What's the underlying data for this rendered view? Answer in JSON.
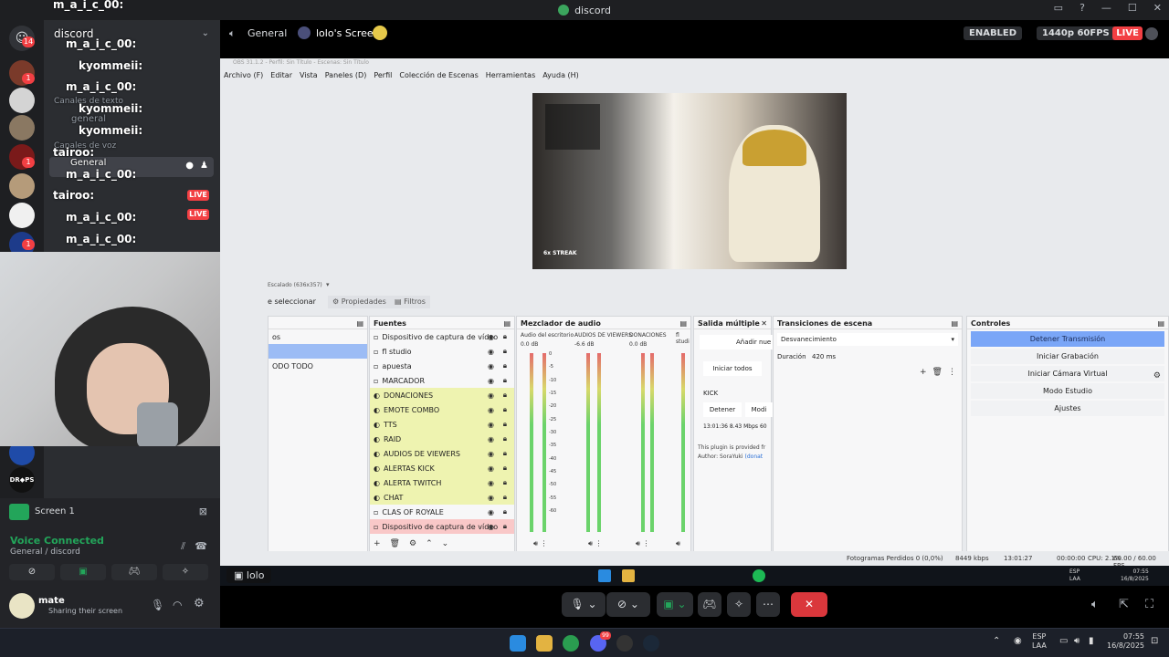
{
  "window": {
    "title": "discord"
  },
  "rail": {
    "badge_top": "14",
    "badge_1": "1",
    "badge_2": "1",
    "badge_3": "1"
  },
  "chat_overlay": {
    "lines": [
      "m_a_i_c_00:",
      "discord",
      "m_a_i_c_00:",
      "kyommeii:",
      "m_a_i_c_00:",
      "Canales de texto",
      "kyommeii:",
      "general",
      "kyommeii:",
      "Canales de voz",
      "tairoo:",
      "General",
      "m_a_i_c_00:",
      "tairoo:",
      "m_a_i_c_00:",
      "m_a_i_c_00:"
    ],
    "live_label": "LIVE"
  },
  "voice": {
    "screen_label": "Screen 1",
    "status": "Voice Connected",
    "channel": "General / discord"
  },
  "user": {
    "name": "mate",
    "status": "Sharing their screen"
  },
  "stream_header": {
    "channel": "General",
    "screen": "lolo's Screen",
    "enabled": "ENABLED",
    "quality": "1440p 60FPS",
    "live": "LIVE"
  },
  "obs": {
    "title": "OBS 31.1.2 - Perfil: Sin Título - Escenas: Sin Título",
    "menu": [
      "Archivo (F)",
      "Editar",
      "Vista",
      "Paneles (D)",
      "Perfil",
      "Colección de Escenas",
      "Herramientas",
      "Ayuda (H)"
    ],
    "preview_caption": "6x STREAK",
    "scaled_label": "Escalado (636x357)",
    "selection_label": "e seleccionar",
    "properties_btn": "Propiedades",
    "filters_btn": "Filtros",
    "scenes": [
      "os",
      "",
      "ODO TODO"
    ],
    "sources_title": "Fuentes",
    "sources": [
      {
        "name": "Dispositivo de captura de vídeo",
        "color": "none"
      },
      {
        "name": "fl studio",
        "color": "none"
      },
      {
        "name": "apuesta",
        "color": "none"
      },
      {
        "name": "MARCADOR",
        "color": "none"
      },
      {
        "name": "DONACIONES",
        "color": "yellow"
      },
      {
        "name": "EMOTE COMBO",
        "color": "yellow"
      },
      {
        "name": "TTS",
        "color": "yellow"
      },
      {
        "name": "RAID",
        "color": "yellow"
      },
      {
        "name": "AUDIOS DE VIEWERS",
        "color": "yellow"
      },
      {
        "name": "ALERTAS KICK",
        "color": "yellow"
      },
      {
        "name": "ALERTA TWITCH",
        "color": "yellow"
      },
      {
        "name": "CHAT",
        "color": "yellow"
      },
      {
        "name": "CLAS OF ROYALE",
        "color": "none"
      },
      {
        "name": "Dispositivo de captura de vídeo",
        "color": "red"
      }
    ],
    "mixer_title": "Mezclador de audio",
    "mixer_channels": [
      {
        "name": "Audio del escritorio",
        "db": "0.0 dB"
      },
      {
        "name": "AUDIOS DE VIEWERS",
        "db": "-6.6 dB"
      },
      {
        "name": "DONACIONES",
        "db": "0.0 dB"
      },
      {
        "name": "fl studi",
        "db": ""
      }
    ],
    "mixer_ticks": [
      "0",
      "-5",
      "-10",
      "-15",
      "-20",
      "-25",
      "-30",
      "-35",
      "-40",
      "-45",
      "-50",
      "-55",
      "-60"
    ],
    "multi_title": "Salida múltiple",
    "multi_add": "Añadir nue",
    "multi_start": "Iniciar todos",
    "multi_target": "KICK",
    "multi_stop": "Detener",
    "multi_modify": "Modi",
    "multi_stats": "13:01:36  8.43 Mbps  60",
    "multi_note": "This plugin is provided fr",
    "multi_author": "Author: SoraYuki",
    "multi_link": "(donat",
    "transitions_title": "Transiciones de escena",
    "transition_value": "Desvanecimiento",
    "duration_label": "Duración",
    "duration_value": "420 ms",
    "controls_title": "Controles",
    "controls": [
      "Detener Transmisión",
      "Iniciar Grabación",
      "Iniciar Cámara Virtual",
      "Modo Estudio",
      "Ajustes"
    ],
    "status": {
      "dropped": "Fotogramas Perdidos 0 (0,0%)",
      "bitrate": "8449 kbps",
      "stream_time": "13:01:27",
      "rec_time": "00:00:00",
      "cpu": "CPU: 2.1%",
      "fps": "60.00 / 60.00 FPS"
    }
  },
  "inner_taskbar": {
    "lang": "ESP",
    "lang2": "LAA",
    "time": "07:55",
    "date": "16/8/2025"
  },
  "screen_tooltip": "lolo",
  "win_taskbar": {
    "lang": "ESP",
    "lang2": "LAA",
    "time": "07:55",
    "date": "16/8/2025",
    "discord_badge": "99"
  }
}
